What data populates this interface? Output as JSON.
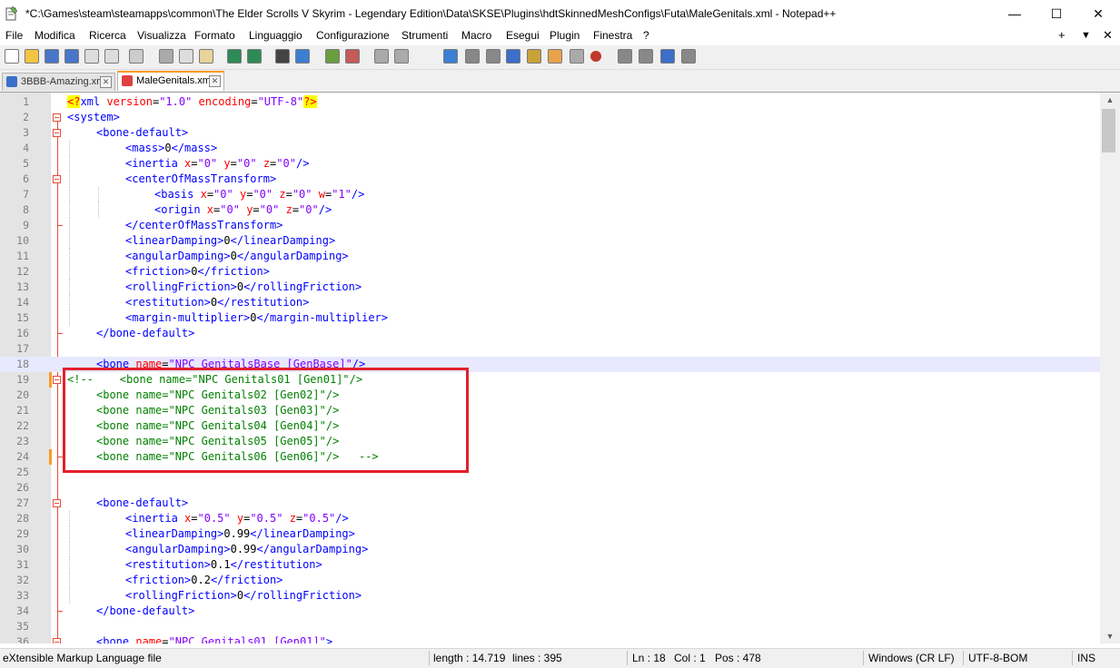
{
  "window": {
    "title": "*C:\\Games\\steam\\steamapps\\common\\The Elder Scrolls V Skyrim - Legendary Edition\\Data\\SKSE\\Plugins\\hdtSkinnedMeshConfigs\\Futa\\MaleGenitals.xml - Notepad++",
    "minimize": "—",
    "maximize": "☐",
    "close": "✕"
  },
  "menu": {
    "items": [
      "File",
      "Modifica",
      "Ricerca",
      "Visualizza",
      "Formato",
      "Linguaggio",
      "Configurazione",
      "Strumenti",
      "Macro",
      "Esegui",
      "Plugin",
      "Finestra",
      "?"
    ],
    "right": [
      "+",
      "▼",
      "✕"
    ]
  },
  "toolbar": {
    "icons": [
      "new-file",
      "open-file",
      "save",
      "save-all",
      "close",
      "close-all",
      "print",
      "cut",
      "copy",
      "paste",
      "undo",
      "redo",
      "find",
      "replace",
      "zoom-in",
      "zoom-out",
      "sync-vertical",
      "sync-horizontal",
      "word-wrap",
      "show-all-chars",
      "indent-guide",
      "document-map",
      "function-list",
      "folder-as-workspace",
      "monitoring",
      "record-macro",
      "stop-macro",
      "play-macro",
      "run-macro-multiple",
      "save-macro"
    ]
  },
  "tabs": [
    {
      "label": "3BBB-Amazing.xml",
      "icon_color": "#3b6fc9",
      "active": false
    },
    {
      "label": "MaleGenitals.xml",
      "icon_color": "#e04040",
      "active": true
    }
  ],
  "editor": {
    "current_line": 18,
    "highlighted_lines": [
      19,
      24
    ],
    "lines": [
      {
        "n": "1",
        "indent": 0,
        "parts": [
          [
            "decl",
            "<?"
          ],
          [
            "t",
            "xml"
          ],
          [
            "tx2",
            " "
          ],
          [
            "a",
            "version"
          ],
          [
            "tx2",
            "="
          ],
          [
            "v",
            "\"1.0\""
          ],
          [
            "tx2",
            " "
          ],
          [
            "a",
            "encoding"
          ],
          [
            "tx2",
            "="
          ],
          [
            "v",
            "\"UTF-8\""
          ],
          [
            "decl",
            "?>"
          ]
        ]
      },
      {
        "n": "2",
        "indent": 0,
        "parts": [
          [
            "t",
            "<system>"
          ]
        ]
      },
      {
        "n": "3",
        "indent": 1,
        "parts": [
          [
            "t",
            "<bone-default>"
          ]
        ]
      },
      {
        "n": "4",
        "indent": 2,
        "parts": [
          [
            "t",
            "<mass>"
          ],
          [
            "tx2",
            "0"
          ],
          [
            "t",
            "</mass>"
          ]
        ]
      },
      {
        "n": "5",
        "indent": 2,
        "parts": [
          [
            "t",
            "<inertia "
          ],
          [
            "a",
            "x"
          ],
          [
            "tx2",
            "="
          ],
          [
            "v",
            "\"0\""
          ],
          [
            "tx2",
            " "
          ],
          [
            "a",
            "y"
          ],
          [
            "tx2",
            "="
          ],
          [
            "v",
            "\"0\""
          ],
          [
            "tx2",
            " "
          ],
          [
            "a",
            "z"
          ],
          [
            "tx2",
            "="
          ],
          [
            "v",
            "\"0\""
          ],
          [
            "t",
            "/>"
          ]
        ]
      },
      {
        "n": "6",
        "indent": 2,
        "parts": [
          [
            "t",
            "<centerOfMassTransform>"
          ]
        ]
      },
      {
        "n": "7",
        "indent": 3,
        "parts": [
          [
            "t",
            "<basis "
          ],
          [
            "a",
            "x"
          ],
          [
            "tx2",
            "="
          ],
          [
            "v",
            "\"0\""
          ],
          [
            "tx2",
            " "
          ],
          [
            "a",
            "y"
          ],
          [
            "tx2",
            "="
          ],
          [
            "v",
            "\"0\""
          ],
          [
            "tx2",
            " "
          ],
          [
            "a",
            "z"
          ],
          [
            "tx2",
            "="
          ],
          [
            "v",
            "\"0\""
          ],
          [
            "tx2",
            " "
          ],
          [
            "a",
            "w"
          ],
          [
            "tx2",
            "="
          ],
          [
            "v",
            "\"1\""
          ],
          [
            "t",
            "/>"
          ]
        ]
      },
      {
        "n": "8",
        "indent": 3,
        "parts": [
          [
            "t",
            "<origin "
          ],
          [
            "a",
            "x"
          ],
          [
            "tx2",
            "="
          ],
          [
            "v",
            "\"0\""
          ],
          [
            "tx2",
            " "
          ],
          [
            "a",
            "y"
          ],
          [
            "tx2",
            "="
          ],
          [
            "v",
            "\"0\""
          ],
          [
            "tx2",
            " "
          ],
          [
            "a",
            "z"
          ],
          [
            "tx2",
            "="
          ],
          [
            "v",
            "\"0\""
          ],
          [
            "t",
            "/>"
          ]
        ]
      },
      {
        "n": "9",
        "indent": 2,
        "parts": [
          [
            "t",
            "</centerOfMassTransform>"
          ]
        ]
      },
      {
        "n": "10",
        "indent": 2,
        "parts": [
          [
            "t",
            "<linearDamping>"
          ],
          [
            "tx2",
            "0"
          ],
          [
            "t",
            "</linearDamping>"
          ]
        ]
      },
      {
        "n": "11",
        "indent": 2,
        "parts": [
          [
            "t",
            "<angularDamping>"
          ],
          [
            "tx2",
            "0"
          ],
          [
            "t",
            "</angularDamping>"
          ]
        ]
      },
      {
        "n": "12",
        "indent": 2,
        "parts": [
          [
            "t",
            "<friction>"
          ],
          [
            "tx2",
            "0"
          ],
          [
            "t",
            "</friction>"
          ]
        ]
      },
      {
        "n": "13",
        "indent": 2,
        "parts": [
          [
            "t",
            "<rollingFriction>"
          ],
          [
            "tx2",
            "0"
          ],
          [
            "t",
            "</rollingFriction>"
          ]
        ]
      },
      {
        "n": "14",
        "indent": 2,
        "parts": [
          [
            "t",
            "<restitution>"
          ],
          [
            "tx2",
            "0"
          ],
          [
            "t",
            "</restitution>"
          ]
        ]
      },
      {
        "n": "15",
        "indent": 2,
        "parts": [
          [
            "t",
            "<margin-multiplier>"
          ],
          [
            "tx2",
            "0"
          ],
          [
            "t",
            "</margin-multiplier>"
          ]
        ]
      },
      {
        "n": "16",
        "indent": 1,
        "parts": [
          [
            "t",
            "</bone-default>"
          ]
        ]
      },
      {
        "n": "17",
        "indent": 0,
        "parts": []
      },
      {
        "n": "18",
        "indent": 1,
        "parts": [
          [
            "t",
            "<bone "
          ],
          [
            "a",
            "name"
          ],
          [
            "tx2",
            "="
          ],
          [
            "v",
            "\"NPC GenitalsBase [GenBase]\""
          ],
          [
            "t",
            "/>"
          ]
        ]
      },
      {
        "n": "19",
        "indent": 0,
        "parts": [
          [
            "cm",
            "<!--    <bone name=\"NPC Genitals01 [Gen01]\"/>"
          ]
        ]
      },
      {
        "n": "20",
        "indent": 1,
        "parts": [
          [
            "cm",
            "<bone name=\"NPC Genitals02 [Gen02]\"/>"
          ]
        ]
      },
      {
        "n": "21",
        "indent": 1,
        "parts": [
          [
            "cm",
            "<bone name=\"NPC Genitals03 [Gen03]\"/>"
          ]
        ]
      },
      {
        "n": "22",
        "indent": 1,
        "parts": [
          [
            "cm",
            "<bone name=\"NPC Genitals04 [Gen04]\"/>"
          ]
        ]
      },
      {
        "n": "23",
        "indent": 1,
        "parts": [
          [
            "cm",
            "<bone name=\"NPC Genitals05 [Gen05]\"/>"
          ]
        ]
      },
      {
        "n": "24",
        "indent": 1,
        "parts": [
          [
            "cm",
            "<bone name=\"NPC Genitals06 [Gen06]\"/>   -->"
          ]
        ]
      },
      {
        "n": "25",
        "indent": 0,
        "parts": []
      },
      {
        "n": "26",
        "indent": 0,
        "parts": []
      },
      {
        "n": "27",
        "indent": 1,
        "parts": [
          [
            "t",
            "<bone-default>"
          ]
        ]
      },
      {
        "n": "28",
        "indent": 2,
        "parts": [
          [
            "t",
            "<inertia "
          ],
          [
            "a",
            "x"
          ],
          [
            "tx2",
            "="
          ],
          [
            "v",
            "\"0.5\""
          ],
          [
            "tx2",
            " "
          ],
          [
            "a",
            "y"
          ],
          [
            "tx2",
            "="
          ],
          [
            "v",
            "\"0.5\""
          ],
          [
            "tx2",
            " "
          ],
          [
            "a",
            "z"
          ],
          [
            "tx2",
            "="
          ],
          [
            "v",
            "\"0.5\""
          ],
          [
            "t",
            "/>"
          ]
        ]
      },
      {
        "n": "29",
        "indent": 2,
        "parts": [
          [
            "t",
            "<linearDamping>"
          ],
          [
            "tx2",
            "0.99"
          ],
          [
            "t",
            "</linearDamping>"
          ]
        ]
      },
      {
        "n": "30",
        "indent": 2,
        "parts": [
          [
            "t",
            "<angularDamping>"
          ],
          [
            "tx2",
            "0.99"
          ],
          [
            "t",
            "</angularDamping>"
          ]
        ]
      },
      {
        "n": "31",
        "indent": 2,
        "parts": [
          [
            "t",
            "<restitution>"
          ],
          [
            "tx2",
            "0.1"
          ],
          [
            "t",
            "</restitution>"
          ]
        ]
      },
      {
        "n": "32",
        "indent": 2,
        "parts": [
          [
            "t",
            "<friction>"
          ],
          [
            "tx2",
            "0.2"
          ],
          [
            "t",
            "</friction>"
          ]
        ]
      },
      {
        "n": "33",
        "indent": 2,
        "parts": [
          [
            "t",
            "<rollingFriction>"
          ],
          [
            "tx2",
            "0"
          ],
          [
            "t",
            "</rollingFriction>"
          ]
        ]
      },
      {
        "n": "34",
        "indent": 1,
        "parts": [
          [
            "t",
            "</bone-default>"
          ]
        ]
      },
      {
        "n": "35",
        "indent": 0,
        "parts": []
      },
      {
        "n": "36",
        "indent": 1,
        "parts": [
          [
            "t",
            "<bone "
          ],
          [
            "a",
            "name"
          ],
          [
            "tx2",
            "="
          ],
          [
            "v",
            "\"NPC Genitals01 [Gen01]\""
          ],
          [
            "t",
            ">"
          ]
        ]
      }
    ]
  },
  "status": {
    "file_type": "eXtensible Markup Language file",
    "length": "length : 14.719",
    "lines": "lines : 395",
    "ln": "Ln : 18",
    "col": "Col : 1",
    "pos": "Pos : 478",
    "eol": "Windows (CR LF)",
    "encoding": "UTF-8-BOM",
    "mode": "INS"
  },
  "colors": {
    "tag": "#0000ff",
    "attr": "#ff0000",
    "value": "#8000ff",
    "comment": "#008000",
    "annotation_box": "#e2202c",
    "active_tab_accent": "#fa9b22"
  }
}
